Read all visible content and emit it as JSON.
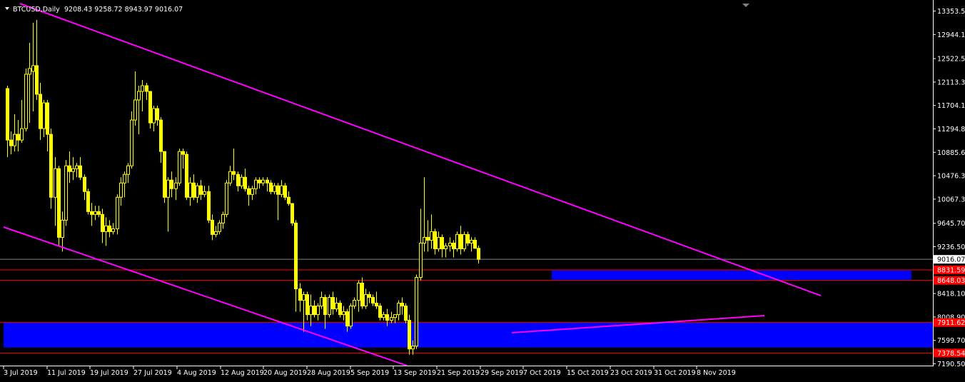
{
  "header": {
    "symbol_label": "BTCUSD,Daily",
    "ohlc_label": "9208.43 9258.72 8943.97 9016.07"
  },
  "colors": {
    "background": "#000000",
    "candle_bull": "#000000",
    "candle_bear": "#ffff00",
    "candle_outline": "#ffff00",
    "trendline": "#ff00ff",
    "zone": "#0000ff",
    "level_line": "#ff0000",
    "price_line": "#808080",
    "axis_text": "#ffffff",
    "price_tag_red": "#ff0000"
  },
  "chart_data": {
    "type": "candlestick",
    "symbol": "BTCUSD",
    "timeframe": "Daily",
    "ylim": [
      7190,
      13400
    ],
    "y_ticks": [
      "13353.50",
      "12944.10",
      "12522.50",
      "12113.30",
      "11704.10",
      "11294.80",
      "10885.60",
      "10476.30",
      "10067.30",
      "9645.70",
      "9236.50",
      "8418.10",
      "8008.90",
      "7599.70",
      "7190.50"
    ],
    "x_tick_labels": [
      "3 Jul 2019",
      "11 Jul 2019",
      "19 Jul 2019",
      "27 Jul 2019",
      "4 Aug 2019",
      "12 Aug 2019",
      "20 Aug 2019",
      "28 Aug 2019",
      "5 Sep 2019",
      "13 Sep 2019",
      "21 Sep 2019",
      "29 Sep 2019",
      "7 Oct 2019",
      "15 Oct 2019",
      "23 Oct 2019",
      "31 Oct 2019",
      "8 Nov 2019"
    ],
    "current_price": {
      "value": 9016.07,
      "label": "9016.07"
    },
    "levels": [
      {
        "value": 8831.59,
        "label": "8831.59"
      },
      {
        "value": 8648.03,
        "label": "8648.03"
      },
      {
        "value": 7911.62,
        "label": "7911.62"
      },
      {
        "value": 7378.54,
        "label": "7378.54"
      }
    ],
    "zones": [
      {
        "name": "upper-zone",
        "start": "7 Oct 2019",
        "end": "extends right",
        "top": 8820,
        "bottom": 8660
      },
      {
        "name": "lower-zone",
        "start": "3 Jul 2019",
        "end": "extends right",
        "top": 7911.62,
        "bottom": 7475
      }
    ],
    "trendlines": [
      {
        "name": "upper-channel",
        "from": {
          "date": "3 Jul 2019",
          "price": 13400
        },
        "to": {
          "date": "19 Nov 2019",
          "price": 8400
        }
      },
      {
        "name": "lower-channel",
        "from": {
          "date": "2 Jul 2019",
          "price": 9570
        },
        "to": {
          "date": "10 Sep 2019",
          "price": 7190
        }
      },
      {
        "name": "support-line",
        "from": {
          "date": "29 Sep 2019",
          "price": 7780
        },
        "to": {
          "date": "13 Nov 2019",
          "price": 8040
        }
      }
    ],
    "candles": [
      {
        "o": 12000,
        "h": 12050,
        "l": 10800,
        "c": 11100
      },
      {
        "o": 11100,
        "h": 11250,
        "l": 10850,
        "c": 11000
      },
      {
        "o": 11000,
        "h": 11550,
        "l": 10900,
        "c": 11200
      },
      {
        "o": 11200,
        "h": 11450,
        "l": 10900,
        "c": 11100
      },
      {
        "o": 11100,
        "h": 11800,
        "l": 11050,
        "c": 11300
      },
      {
        "o": 11300,
        "h": 12350,
        "l": 11250,
        "c": 12250
      },
      {
        "o": 12250,
        "h": 12800,
        "l": 11400,
        "c": 12350
      },
      {
        "o": 12300,
        "h": 13150,
        "l": 11600,
        "c": 12400
      },
      {
        "o": 12400,
        "h": 13200,
        "l": 11800,
        "c": 11900
      },
      {
        "o": 11900,
        "h": 12100,
        "l": 11100,
        "c": 11300
      },
      {
        "o": 11300,
        "h": 11800,
        "l": 11150,
        "c": 11750
      },
      {
        "o": 11750,
        "h": 11800,
        "l": 10900,
        "c": 11200
      },
      {
        "o": 11200,
        "h": 11300,
        "l": 9900,
        "c": 10100
      },
      {
        "o": 10100,
        "h": 10800,
        "l": 9600,
        "c": 10600
      },
      {
        "o": 10600,
        "h": 10650,
        "l": 9250,
        "c": 9400
      },
      {
        "o": 9400,
        "h": 9850,
        "l": 9150,
        "c": 9700
      },
      {
        "o": 9700,
        "h": 10750,
        "l": 9600,
        "c": 10650
      },
      {
        "o": 10650,
        "h": 10900,
        "l": 10350,
        "c": 10550
      },
      {
        "o": 10550,
        "h": 10800,
        "l": 10400,
        "c": 10600
      },
      {
        "o": 10600,
        "h": 10700,
        "l": 10450,
        "c": 10650
      },
      {
        "o": 10650,
        "h": 10800,
        "l": 10400,
        "c": 10450
      },
      {
        "o": 10450,
        "h": 10500,
        "l": 10050,
        "c": 10200
      },
      {
        "o": 10200,
        "h": 10250,
        "l": 9800,
        "c": 9850
      },
      {
        "o": 9850,
        "h": 10000,
        "l": 9600,
        "c": 9800
      },
      {
        "o": 9800,
        "h": 9950,
        "l": 9700,
        "c": 9850
      },
      {
        "o": 9850,
        "h": 9950,
        "l": 9750,
        "c": 9800
      },
      {
        "o": 9800,
        "h": 9900,
        "l": 9300,
        "c": 9500
      },
      {
        "o": 9500,
        "h": 9750,
        "l": 9250,
        "c": 9600
      },
      {
        "o": 9600,
        "h": 9700,
        "l": 9400,
        "c": 9500
      },
      {
        "o": 9500,
        "h": 9650,
        "l": 9450,
        "c": 9550
      },
      {
        "o": 9550,
        "h": 10150,
        "l": 9450,
        "c": 10100
      },
      {
        "o": 10100,
        "h": 10450,
        "l": 9950,
        "c": 10350
      },
      {
        "o": 10350,
        "h": 10550,
        "l": 10100,
        "c": 10500
      },
      {
        "o": 10500,
        "h": 10700,
        "l": 10350,
        "c": 10650
      },
      {
        "o": 10650,
        "h": 11600,
        "l": 10600,
        "c": 11450
      },
      {
        "o": 11450,
        "h": 12300,
        "l": 11350,
        "c": 11800
      },
      {
        "o": 11800,
        "h": 12050,
        "l": 11200,
        "c": 11950
      },
      {
        "o": 11950,
        "h": 12150,
        "l": 11600,
        "c": 12050
      },
      {
        "o": 12050,
        "h": 12100,
        "l": 11800,
        "c": 11950
      },
      {
        "o": 11950,
        "h": 11900,
        "l": 11300,
        "c": 11400
      },
      {
        "o": 11400,
        "h": 11700,
        "l": 11250,
        "c": 11650
      },
      {
        "o": 11650,
        "h": 11700,
        "l": 11350,
        "c": 11450
      },
      {
        "o": 11450,
        "h": 11500,
        "l": 10700,
        "c": 10900
      },
      {
        "o": 10900,
        "h": 10850,
        "l": 10000,
        "c": 10100
      },
      {
        "o": 10100,
        "h": 10450,
        "l": 9500,
        "c": 10400
      },
      {
        "o": 10400,
        "h": 10550,
        "l": 10100,
        "c": 10250
      },
      {
        "o": 10250,
        "h": 10450,
        "l": 10050,
        "c": 10350
      },
      {
        "o": 10350,
        "h": 10950,
        "l": 10300,
        "c": 10900
      },
      {
        "o": 10900,
        "h": 10950,
        "l": 10600,
        "c": 10850
      },
      {
        "o": 10850,
        "h": 10900,
        "l": 10050,
        "c": 10100
      },
      {
        "o": 10100,
        "h": 10450,
        "l": 9950,
        "c": 10350
      },
      {
        "o": 10350,
        "h": 10500,
        "l": 10050,
        "c": 10100
      },
      {
        "o": 10100,
        "h": 10350,
        "l": 10000,
        "c": 10300
      },
      {
        "o": 10300,
        "h": 10400,
        "l": 10050,
        "c": 10150
      },
      {
        "o": 10150,
        "h": 10300,
        "l": 10100,
        "c": 10200
      },
      {
        "o": 10200,
        "h": 10300,
        "l": 9650,
        "c": 9700
      },
      {
        "o": 9700,
        "h": 9800,
        "l": 9350,
        "c": 9450
      },
      {
        "o": 9450,
        "h": 9600,
        "l": 9400,
        "c": 9500
      },
      {
        "o": 9500,
        "h": 9700,
        "l": 9450,
        "c": 9650
      },
      {
        "o": 9650,
        "h": 9850,
        "l": 9550,
        "c": 9800
      },
      {
        "o": 9800,
        "h": 10400,
        "l": 9750,
        "c": 10350
      },
      {
        "o": 10350,
        "h": 10650,
        "l": 10300,
        "c": 10550
      },
      {
        "o": 10550,
        "h": 10950,
        "l": 10400,
        "c": 10500
      },
      {
        "o": 10500,
        "h": 10550,
        "l": 10200,
        "c": 10300
      },
      {
        "o": 10300,
        "h": 10500,
        "l": 10250,
        "c": 10450
      },
      {
        "o": 10450,
        "h": 10600,
        "l": 10200,
        "c": 10250
      },
      {
        "o": 10250,
        "h": 10300,
        "l": 9950,
        "c": 10150
      },
      {
        "o": 10150,
        "h": 10300,
        "l": 10050,
        "c": 10250
      },
      {
        "o": 10250,
        "h": 10450,
        "l": 10150,
        "c": 10400
      },
      {
        "o": 10400,
        "h": 10450,
        "l": 10250,
        "c": 10350
      },
      {
        "o": 10350,
        "h": 10450,
        "l": 10300,
        "c": 10400
      },
      {
        "o": 10400,
        "h": 10450,
        "l": 10200,
        "c": 10350
      },
      {
        "o": 10350,
        "h": 10400,
        "l": 10150,
        "c": 10200
      },
      {
        "o": 10200,
        "h": 10350,
        "l": 10150,
        "c": 10300
      },
      {
        "o": 10300,
        "h": 10350,
        "l": 9700,
        "c": 10150
      },
      {
        "o": 10150,
        "h": 10400,
        "l": 10100,
        "c": 10300
      },
      {
        "o": 10300,
        "h": 10350,
        "l": 10050,
        "c": 10100
      },
      {
        "o": 10100,
        "h": 10200,
        "l": 9950,
        "c": 9990
      },
      {
        "o": 9990,
        "h": 10000,
        "l": 9600,
        "c": 9650
      },
      {
        "o": 9650,
        "h": 9700,
        "l": 8100,
        "c": 8500
      },
      {
        "o": 8500,
        "h": 8600,
        "l": 8100,
        "c": 8300
      },
      {
        "o": 8300,
        "h": 8450,
        "l": 7750,
        "c": 8400
      },
      {
        "o": 8400,
        "h": 8450,
        "l": 7950,
        "c": 8050
      },
      {
        "o": 8050,
        "h": 8400,
        "l": 7850,
        "c": 8200
      },
      {
        "o": 8200,
        "h": 8300,
        "l": 8000,
        "c": 8050
      },
      {
        "o": 8050,
        "h": 8250,
        "l": 7950,
        "c": 8200
      },
      {
        "o": 8200,
        "h": 8450,
        "l": 8150,
        "c": 8350
      },
      {
        "o": 8350,
        "h": 8400,
        "l": 7800,
        "c": 8050
      },
      {
        "o": 8050,
        "h": 8400,
        "l": 8000,
        "c": 8350
      },
      {
        "o": 8350,
        "h": 8450,
        "l": 8050,
        "c": 8150
      },
      {
        "o": 8150,
        "h": 8350,
        "l": 8100,
        "c": 8250
      },
      {
        "o": 8250,
        "h": 8300,
        "l": 8000,
        "c": 8050
      },
      {
        "o": 8050,
        "h": 8200,
        "l": 7950,
        "c": 8100
      },
      {
        "o": 8100,
        "h": 8150,
        "l": 7750,
        "c": 7850
      },
      {
        "o": 7850,
        "h": 8250,
        "l": 7800,
        "c": 8200
      },
      {
        "o": 8200,
        "h": 8350,
        "l": 8150,
        "c": 8300
      },
      {
        "o": 8300,
        "h": 8650,
        "l": 8100,
        "c": 8600
      },
      {
        "o": 8600,
        "h": 8700,
        "l": 8150,
        "c": 8200
      },
      {
        "o": 8200,
        "h": 8500,
        "l": 8150,
        "c": 8400
      },
      {
        "o": 8400,
        "h": 8450,
        "l": 8250,
        "c": 8350
      },
      {
        "o": 8350,
        "h": 8400,
        "l": 8200,
        "c": 8250
      },
      {
        "o": 8250,
        "h": 8450,
        "l": 8150,
        "c": 8200
      },
      {
        "o": 8200,
        "h": 8250,
        "l": 7950,
        "c": 8000
      },
      {
        "o": 8000,
        "h": 8100,
        "l": 7950,
        "c": 8050
      },
      {
        "o": 8050,
        "h": 8150,
        "l": 7850,
        "c": 7950
      },
      {
        "o": 7950,
        "h": 8100,
        "l": 7900,
        "c": 8000
      },
      {
        "o": 8000,
        "h": 8050,
        "l": 7900,
        "c": 8050
      },
      {
        "o": 8050,
        "h": 8300,
        "l": 7950,
        "c": 8250
      },
      {
        "o": 8250,
        "h": 8350,
        "l": 8050,
        "c": 8200
      },
      {
        "o": 8200,
        "h": 8250,
        "l": 7900,
        "c": 7950
      },
      {
        "o": 7950,
        "h": 8050,
        "l": 7350,
        "c": 7450
      },
      {
        "o": 7450,
        "h": 7600,
        "l": 7350,
        "c": 7500
      },
      {
        "o": 7500,
        "h": 8750,
        "l": 7450,
        "c": 8700
      },
      {
        "o": 8700,
        "h": 9900,
        "l": 8650,
        "c": 9300
      },
      {
        "o": 9300,
        "h": 10450,
        "l": 9150,
        "c": 9400
      },
      {
        "o": 9400,
        "h": 9700,
        "l": 9150,
        "c": 9350
      },
      {
        "o": 9350,
        "h": 9800,
        "l": 9200,
        "c": 9500
      },
      {
        "o": 9500,
        "h": 9550,
        "l": 9100,
        "c": 9200
      },
      {
        "o": 9200,
        "h": 9500,
        "l": 9150,
        "c": 9400
      },
      {
        "o": 9400,
        "h": 9450,
        "l": 9050,
        "c": 9200
      },
      {
        "o": 9200,
        "h": 9300,
        "l": 9050,
        "c": 9250
      },
      {
        "o": 9250,
        "h": 9400,
        "l": 9150,
        "c": 9300
      },
      {
        "o": 9300,
        "h": 9350,
        "l": 9050,
        "c": 9200
      },
      {
        "o": 9200,
        "h": 9500,
        "l": 9150,
        "c": 9450
      },
      {
        "o": 9450,
        "h": 9600,
        "l": 9100,
        "c": 9200
      },
      {
        "o": 9200,
        "h": 9500,
        "l": 9150,
        "c": 9450
      },
      {
        "o": 9450,
        "h": 9500,
        "l": 9250,
        "c": 9300
      },
      {
        "o": 9300,
        "h": 9400,
        "l": 9150,
        "c": 9350
      },
      {
        "o": 9350,
        "h": 9400,
        "l": 9250,
        "c": 9208
      },
      {
        "o": 9208.43,
        "h": 9258.72,
        "l": 8943.97,
        "c": 9016.07
      }
    ]
  }
}
